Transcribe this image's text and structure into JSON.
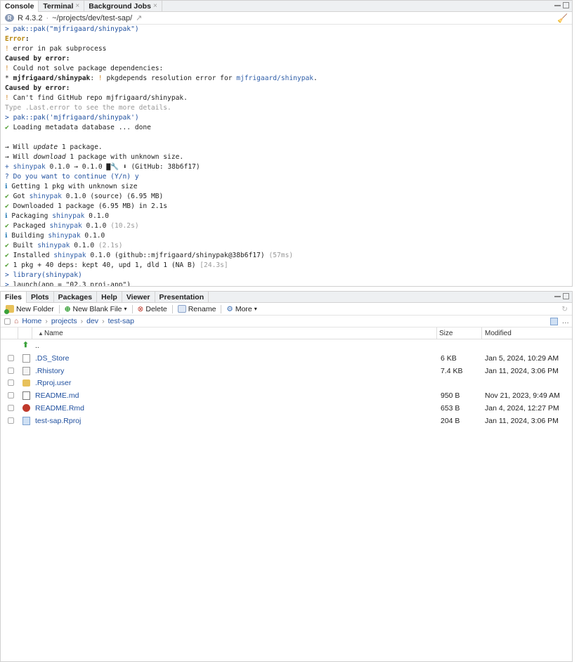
{
  "console_pane": {
    "tabs": [
      {
        "label": "Console",
        "active": true,
        "closable": false
      },
      {
        "label": "Terminal",
        "active": false,
        "closable": true
      },
      {
        "label": "Background Jobs",
        "active": false,
        "closable": true
      }
    ],
    "r_version": "R 4.3.2",
    "path": "~/projects/dev/test-sap/"
  },
  "console_lines": [
    [
      {
        "t": "> ",
        "c": "prompt"
      },
      {
        "t": "pak::pak(\"mjfrigaard/shinypak\")",
        "c": "cmd"
      }
    ],
    [
      {
        "t": "Error",
        "c": "err"
      },
      {
        "t": ":",
        "c": "bold"
      }
    ],
    [
      {
        "t": "! ",
        "c": "bang"
      },
      {
        "t": "error in pak subprocess"
      }
    ],
    [
      {
        "t": "Caused by error",
        "c": "bold"
      },
      {
        "t": ":",
        "c": "bold"
      }
    ],
    [
      {
        "t": "! ",
        "c": "bang"
      },
      {
        "t": "Could not solve package dependencies:"
      }
    ],
    [
      {
        "t": "* "
      },
      {
        "t": "mjfrigaard/shinypak",
        "c": "bold"
      },
      {
        "t": ": "
      },
      {
        "t": "! ",
        "c": "bang"
      },
      {
        "t": "pkgdepends resolution error for "
      },
      {
        "t": "mjfrigaard/shinypak",
        "c": "pkg"
      },
      {
        "t": "."
      }
    ],
    [
      {
        "t": "Caused by error",
        "c": "bold"
      },
      {
        "t": ":",
        "c": "bold"
      }
    ],
    [
      {
        "t": "! ",
        "c": "bang"
      },
      {
        "t": "Can't find GitHub repo mjfrigaard/shinypak."
      }
    ],
    [
      {
        "t": "Type .Last.error to see the more details.",
        "c": "dim"
      }
    ],
    [
      {
        "t": "> ",
        "c": "prompt"
      },
      {
        "t": "pak::pak('mjfrigaard/shinypak')",
        "c": "cmd"
      }
    ],
    [
      {
        "t": "✔ ",
        "c": "check"
      },
      {
        "t": "Loading metadata database ... done"
      }
    ],
    [
      {
        "t": ""
      }
    ],
    [
      {
        "t": "→ Will "
      },
      {
        "t": "update",
        "c": "ital"
      },
      {
        "t": " 1 package."
      }
    ],
    [
      {
        "t": "→ Will "
      },
      {
        "t": "download",
        "c": "ital"
      },
      {
        "t": " 1 package with unknown size."
      }
    ],
    [
      {
        "t": "+ ",
        "c": "pkg"
      },
      {
        "t": "shinypak",
        "c": "pkg"
      },
      {
        "t": " 0.1.0 → 0.1.0 "
      },
      {
        "t": "▇🔧 ⬇",
        "c": "bold"
      },
      {
        "t": " (GitHub: 38b6f17)"
      }
    ],
    [
      {
        "t": "? ",
        "c": "blue"
      },
      {
        "t": "Do you want to continue (Y/n) y",
        "c": "blue"
      }
    ],
    [
      {
        "t": "ℹ ",
        "c": "info"
      },
      {
        "t": "Getting 1 pkg with unknown size"
      }
    ],
    [
      {
        "t": "✔ ",
        "c": "check"
      },
      {
        "t": "Got "
      },
      {
        "t": "shinypak",
        "c": "pkg"
      },
      {
        "t": " 0.1.0 (source) (6.95 MB)"
      }
    ],
    [
      {
        "t": "✔ ",
        "c": "check"
      },
      {
        "t": "Downloaded 1 package (6.95 MB) in 2.1s"
      }
    ],
    [
      {
        "t": "ℹ ",
        "c": "info"
      },
      {
        "t": "Packaging "
      },
      {
        "t": "shinypak",
        "c": "pkg"
      },
      {
        "t": " 0.1.0"
      }
    ],
    [
      {
        "t": "✔ ",
        "c": "check"
      },
      {
        "t": "Packaged "
      },
      {
        "t": "shinypak",
        "c": "pkg"
      },
      {
        "t": " 0.1.0 "
      },
      {
        "t": "(10.2s)",
        "c": "dim"
      }
    ],
    [
      {
        "t": "ℹ ",
        "c": "info"
      },
      {
        "t": "Building "
      },
      {
        "t": "shinypak",
        "c": "pkg"
      },
      {
        "t": " 0.1.0"
      }
    ],
    [
      {
        "t": "✔ ",
        "c": "check"
      },
      {
        "t": "Built "
      },
      {
        "t": "shinypak",
        "c": "pkg"
      },
      {
        "t": " 0.1.0 "
      },
      {
        "t": "(2.1s)",
        "c": "dim"
      }
    ],
    [
      {
        "t": "✔ ",
        "c": "check"
      },
      {
        "t": "Installed "
      },
      {
        "t": "shinypak",
        "c": "pkg"
      },
      {
        "t": " 0.1.0 (github::mjfrigaard/shinypak@38b6f17) "
      },
      {
        "t": "(57ms)",
        "c": "dim"
      }
    ],
    [
      {
        "t": "✔ ",
        "c": "check"
      },
      {
        "t": "1 pkg + 40 deps: kept 40, upd 1, dld 1 (NA B) "
      },
      {
        "t": "[24.3s]",
        "c": "dim"
      }
    ],
    [
      {
        "t": "> ",
        "c": "prompt"
      },
      {
        "t": "library(shinypak)",
        "c": "cmd"
      }
    ],
    [
      {
        "t": "> ",
        "c": "prompt"
      },
      {
        "t": "launch(app = \"02.3_proj-app\")"
      }
    ]
  ],
  "files_pane": {
    "tabs": [
      {
        "label": "Files",
        "active": true
      },
      {
        "label": "Plots",
        "active": false
      },
      {
        "label": "Packages",
        "active": false
      },
      {
        "label": "Help",
        "active": false
      },
      {
        "label": "Viewer",
        "active": false
      },
      {
        "label": "Presentation",
        "active": false
      }
    ],
    "toolbar": {
      "new_folder": "New Folder",
      "new_blank_file": "New Blank File",
      "delete": "Delete",
      "rename": "Rename",
      "more": "More"
    },
    "breadcrumb": [
      "Home",
      "projects",
      "dev",
      "test-sap"
    ],
    "columns": {
      "name": "Name",
      "size": "Size",
      "modified": "Modified"
    },
    "up_dir": "..",
    "files": [
      {
        "name": ".DS_Store",
        "size": "6 KB",
        "modified": "Jan 5, 2024, 10:29 AM",
        "icon": "blank-file-icon"
      },
      {
        "name": ".Rhistory",
        "size": "7.4 KB",
        "modified": "Jan 11, 2024, 3:06 PM",
        "icon": "r-history-icon"
      },
      {
        "name": ".Rproj.user",
        "size": "",
        "modified": "",
        "icon": "folder-icon"
      },
      {
        "name": "README.md",
        "size": "950 B",
        "modified": "Nov 21, 2023, 9:49 AM",
        "icon": "markdown-icon"
      },
      {
        "name": "README.Rmd",
        "size": "653 B",
        "modified": "Jan 4, 2024, 12:27 PM",
        "icon": "rmarkdown-icon"
      },
      {
        "name": "test-sap.Rproj",
        "size": "204 B",
        "modified": "Jan 11, 2024, 3:06 PM",
        "icon": "rproj-icon"
      }
    ]
  },
  "colors": {
    "accent_blue": "#1f4f9e",
    "error_yellow": "#b7860b",
    "check_green": "#4a9a2a"
  }
}
